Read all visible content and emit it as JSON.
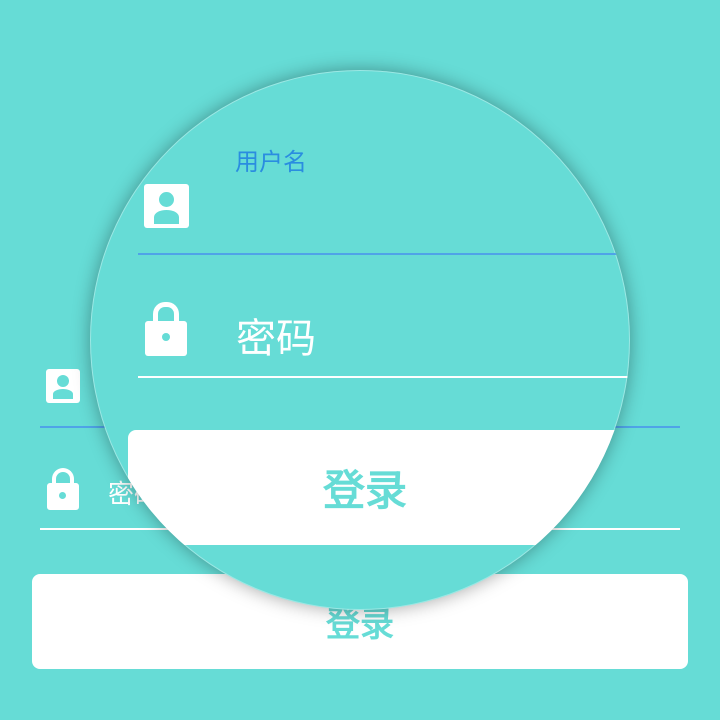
{
  "username": {
    "label": "用户名",
    "icon": "user-icon"
  },
  "password": {
    "placeholder": "密码",
    "icon": "lock-icon"
  },
  "login": {
    "label": "登录"
  },
  "colors": {
    "background": "#66dcd6",
    "accent": "#2a8de0",
    "underline_active": "#4fa3e8",
    "underline": "#ffffff",
    "button_bg": "#ffffff",
    "button_text": "#66dcd6"
  }
}
